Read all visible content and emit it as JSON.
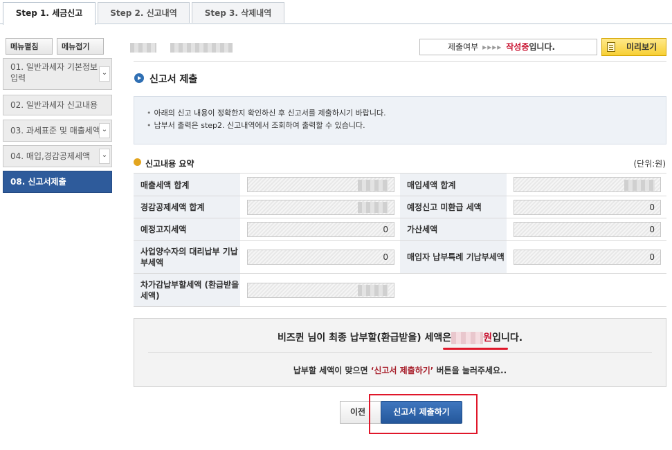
{
  "tabs": [
    {
      "label": "Step 1. 세금신고",
      "active": true
    },
    {
      "label": "Step 2. 신고내역",
      "active": false
    },
    {
      "label": "Step 3. 삭제내역",
      "active": false
    }
  ],
  "sidebar": {
    "expand_label": "메뉴펼침",
    "collapse_label": "메뉴접기",
    "items": [
      {
        "label": "01. 일반과세자 기본정보 입력",
        "expandable": true
      },
      {
        "label": "02. 일반과세자 신고내용",
        "expandable": false
      },
      {
        "label": "03. 과세표준 및 매출세액",
        "expandable": true
      },
      {
        "label": "04. 매입,경감공제세액",
        "expandable": true
      },
      {
        "label": "08. 신고서제출",
        "expandable": false,
        "active": true
      }
    ]
  },
  "status": {
    "label": "제출여부",
    "arrows": "▸▸▸▸",
    "state_text": "작성중",
    "suffix": "입니다."
  },
  "preview_button": "미리보기",
  "section_title": "신고서 제출",
  "notice": [
    "아래의 신고 내용이 정확한지 확인하신 후 신고서를 제출하시기 바랍니다.",
    "납부서 출력은 step2. 신고내역에서 조회하여 출력할 수 있습니다."
  ],
  "summary": {
    "title": "신고내용 요약",
    "unit": "(단위:원)",
    "rows": [
      {
        "l1": "매출세액 합계",
        "v1": "",
        "v1_masked": true,
        "l2": "매입세액 합계",
        "v2": "",
        "v2_masked": true
      },
      {
        "l1": "경감공제세액 합계",
        "v1": "",
        "v1_masked": true,
        "l2": "예정신고 미환급 세액",
        "v2": "0"
      },
      {
        "l1": "예정고지세액",
        "v1": "0",
        "l2": "가산세액",
        "v2": "0"
      },
      {
        "l1": "사업양수자의 대리납부 기납부세액",
        "v1": "0",
        "l2": "매입자 납부특례 기납부세액",
        "v2": "0"
      },
      {
        "l1": "차가감납부할세액 (환급받을세액)",
        "v1": "",
        "v1_masked": true,
        "l2": "",
        "v2": null
      }
    ]
  },
  "final": {
    "line1_prefix": "비즈퀸 님이 최종 납부할(환급받을) 세액은",
    "line1_unit": "원",
    "line1_suffix": "입니다.",
    "line2_prefix": "납부할 세액이 맞으면 ",
    "line2_highlight": "‘신고서 제출하기’",
    "line2_suffix": " 버튼을 눌러주세요.."
  },
  "buttons": {
    "prev": "이전",
    "submit": "신고서 제출하기"
  },
  "colors": {
    "accent_blue": "#2e5b9b",
    "highlight_red": "#e0172a",
    "preview_yellow": "#f7cf35"
  }
}
